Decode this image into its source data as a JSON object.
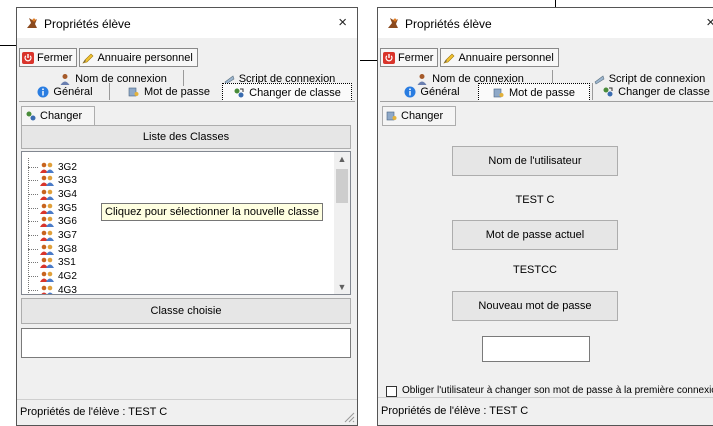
{
  "window": {
    "title": "Propriétés élève",
    "close_glyph": "×"
  },
  "toolbar": {
    "close_label": "Fermer",
    "directory_label": "Annuaire personnel"
  },
  "tabs": {
    "login_name": "Nom de connexion",
    "login_script": "Script de connexion",
    "general": "Général",
    "password": "Mot de passe",
    "change_class": "Changer de classe"
  },
  "left_panel": {
    "change_button": "Changer",
    "class_list_header": "Liste des Classes",
    "classes": [
      "3G2",
      "3G3",
      "3G4",
      "3G5",
      "3G6",
      "3G7",
      "3G8",
      "3S1",
      "4G2",
      "4G3"
    ],
    "tooltip": "Cliquez pour sélectionner la nouvelle classe",
    "chosen_class_header": "Classe choisie",
    "chosen_class_value": ""
  },
  "right_panel": {
    "change_button": "Changer",
    "username_button": "Nom de l'utilisateur",
    "username_value": "TEST C",
    "current_password_button": "Mot de passe actuel",
    "current_password_value": "TESTCC",
    "new_password_button": "Nouveau mot de passe",
    "new_password_value": "",
    "force_change_label": "Obliger l'utilisateur à changer son mot de passe à la première connexion",
    "force_change_checked": false
  },
  "status": {
    "text": "Propriétés de l'élève : TEST C"
  },
  "icons": {
    "app": "bird-icon",
    "close": "power-icon",
    "directory": "pen-icon",
    "user": "user-icon",
    "script": "script-icon",
    "info": "info-icon",
    "lock": "key-icon",
    "class": "swap-class-icon",
    "group": "group-icon"
  },
  "colors": {
    "accent_red": "#d9342b",
    "info_blue": "#2a7de1",
    "tooltip_bg": "#ffffe1"
  }
}
